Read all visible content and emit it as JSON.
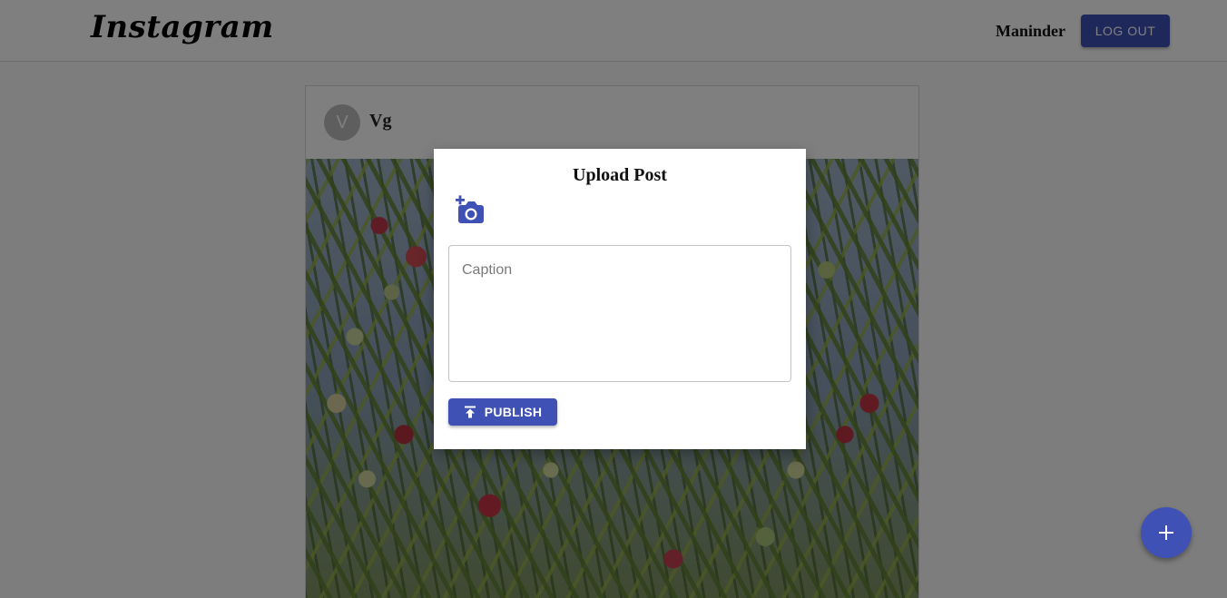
{
  "header": {
    "logo": "Instagram",
    "username": "Maninder",
    "logout_label": "LOG OUT"
  },
  "post": {
    "avatar_initial": "V",
    "username": "Vg"
  },
  "modal": {
    "title": "Upload Post",
    "caption_placeholder": "Caption",
    "caption_value": "",
    "publish_label": "PUBLISH"
  },
  "icons": {
    "camera": "add-a-photo-icon",
    "publish": "publish-icon",
    "fab": "plus-icon"
  },
  "colors": {
    "primary": "#3f51b5",
    "overlay": "rgba(0,0,0,0.5)"
  }
}
